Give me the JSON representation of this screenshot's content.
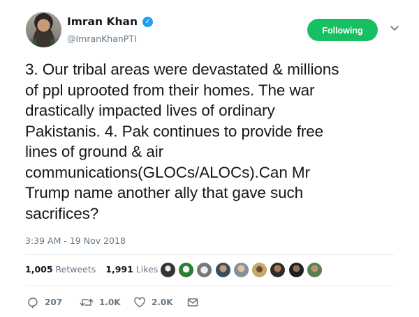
{
  "user": {
    "display_name": "Imran Khan",
    "handle": "@ImranKhanPTI",
    "verified": true
  },
  "follow_button": {
    "label": "Following",
    "color": "#17bf63"
  },
  "tweet": {
    "text": "3. Our tribal areas were devastated & millions\nof ppl uprooted from their homes. The war\ndrastically impacted lives of ordinary\nPakistanis. 4. Pak continues to provide free\nlines of ground & air\ncommunications(GLOCs/ALOCs).Can Mr\nTrump name another ally that gave such\nsacrifices?",
    "timestamp": "3:39 AM - 19 Nov 2018"
  },
  "stats": {
    "retweets_count": "1,005",
    "retweets_label": "Retweets",
    "likes_count": "1,991",
    "likes_label": "Likes"
  },
  "actions": {
    "replies": "207",
    "retweets": "1.0K",
    "likes": "2.0K"
  },
  "colors": {
    "accent": "#1da1f2",
    "muted": "#657786",
    "text": "#14171a",
    "divider": "#e6ecf0"
  }
}
